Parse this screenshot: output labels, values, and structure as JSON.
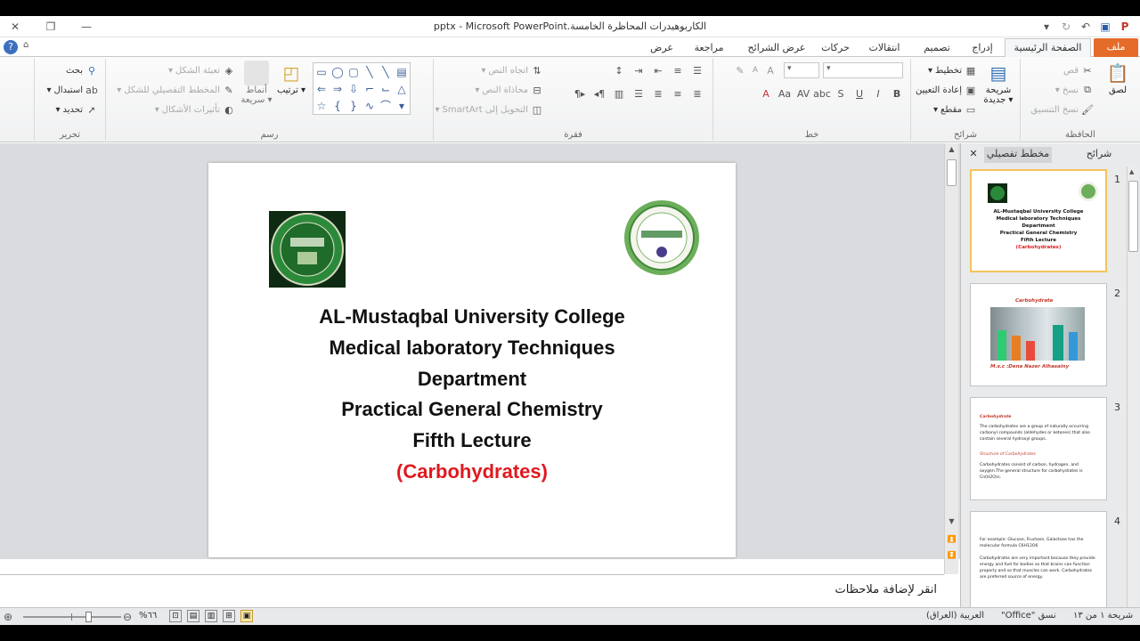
{
  "window": {
    "title": "الكاربوهيدرات المحاظرة الخامسة.pptx  -  Microsoft PowerPoint"
  },
  "tabs": [
    {
      "label": "ملف"
    },
    {
      "label": "الصفحة الرئيسية"
    },
    {
      "label": "إدراج"
    },
    {
      "label": "تصميم"
    },
    {
      "label": "انتقالات"
    },
    {
      "label": "حركات"
    },
    {
      "label": "عرض الشرائح"
    },
    {
      "label": "مراجعة"
    },
    {
      "label": "عرض"
    }
  ],
  "ribbon": {
    "clipboard": {
      "label": "الحافظة",
      "paste": "لصق",
      "cut": "قص",
      "copy": "نسخ",
      "format_painter": "نسخ التنسيق"
    },
    "slides": {
      "label": "شرائح",
      "new_slide_1": "شريحة",
      "new_slide_2": "جديدة",
      "layout": "تخطيط",
      "reset": "إعادة التعيين",
      "section": "مقطع"
    },
    "font": {
      "label": "خط"
    },
    "paragraph": {
      "label": "فقرة",
      "text_direction": "اتجاه النص",
      "align_text": "محاذاة النص",
      "smartart": "التحويل إلى SmartArt"
    },
    "drawing": {
      "label": "رسم",
      "arrange": "ترتيب",
      "quick_styles_1": "أنماط",
      "quick_styles_2": "سريعة",
      "shape_fill": "تعبئة الشكل",
      "shape_outline": "المخطط التفصيلي للشكل",
      "shape_effects": "تأثيرات الأشكال"
    },
    "editing": {
      "label": "تحرير",
      "find": "بحث",
      "replace": "استبدال",
      "select": "تحديد"
    }
  },
  "slide": {
    "lines": [
      "AL-Mustaqbal University College",
      "Medical laboratory Techniques",
      "Department",
      "Practical General Chemistry",
      "Fifth Lecture",
      "(Carbohydrates)"
    ]
  },
  "pane": {
    "tab_slides": "شرائح",
    "tab_outline": "مخطط تفصيلي",
    "thumbs": [
      {
        "num": "1",
        "lines": [
          "AL-Mustaqbal University College",
          "Medical laboratory Techniques",
          "Department",
          "Practical General Chemistry",
          "Fifth Lecture",
          "(Carbohydrates)"
        ]
      },
      {
        "num": "2",
        "title": "Carbohydrate",
        "caption": "M.s.c :Dena Nazer Alhasainy"
      },
      {
        "num": "3",
        "heading": "Carbohydrate",
        "p1": "The carbohydrates are a group of naturally occurring carbonyl compounds (aldehydes or ketones) that also contain several hydroxyl groups.",
        "heading2": "Structure of Carbohydrates",
        "p2": "Carbohydrates consist of carbon, hydrogen, and oxygen.The general structure for carbohydrates is Cn(H2O)n."
      },
      {
        "num": "4",
        "p1": "For example: Glucose, Fructose, Galactose has the molecular formula C6H12O6",
        "p2": "Carbohydrates are very important because they provide energy and fuel for bodies so that brains can function properly and so that muscles can work. Carbohydrates are preferred source of energy."
      }
    ]
  },
  "notes": {
    "placeholder": "انقر لإضافة ملاحظات"
  },
  "status": {
    "slide_count": "شريحة ١ من ١٣",
    "theme": "\"Office\" نسق",
    "language": "العربية (العراق)",
    "zoom": "%٦٦"
  },
  "colors": {
    "file_tab": "#e56b29",
    "title_red": "#e0191f",
    "selected_thumb": "#f2c45b",
    "logo_green": "#1f6b2a"
  }
}
